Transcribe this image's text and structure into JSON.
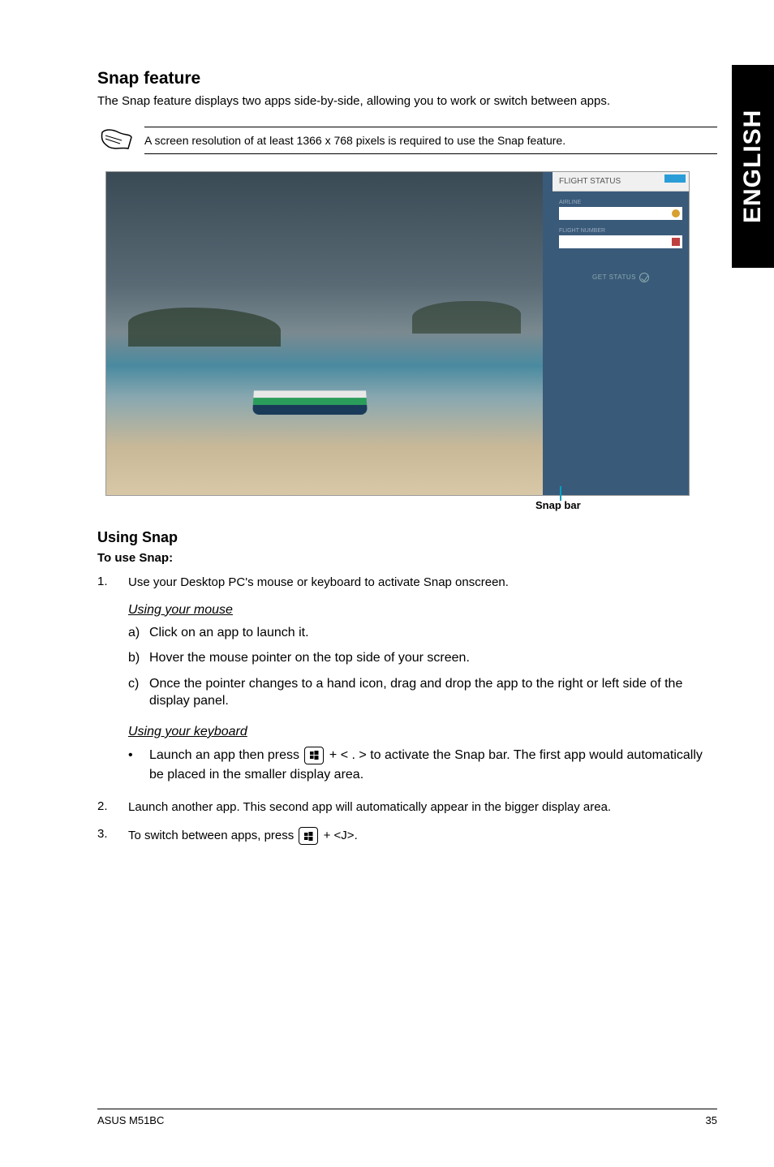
{
  "sideTab": "ENGLISH",
  "title": "Snap feature",
  "intro": "The Snap feature displays two apps side-by-side, allowing you to work or switch between apps.",
  "note": "A screen resolution of at least 1366 x 768 pixels is required to use the Snap feature.",
  "screenshot": {
    "panel_title": "FLIGHT STATUS",
    "field1_label": "AIRLINE",
    "field2_label": "FLIGHT NUMBER",
    "status_text": "GET STATUS"
  },
  "snapBarLabel": "Snap bar",
  "usingTitle": "Using Snap",
  "toUse": "To use Snap:",
  "step1": {
    "num": "1.",
    "text": "Use your Desktop PC's mouse or keyboard to activate Snap onscreen."
  },
  "mouseHeading": "Using your mouse",
  "mouseSteps": {
    "a": {
      "lt": "a)",
      "text": "Click on an app to launch it."
    },
    "b": {
      "lt": "b)",
      "text": "Hover the mouse pointer on the top side of your screen."
    },
    "c": {
      "lt": "c)",
      "text": "Once the pointer changes to a hand icon, drag and drop the app to the right or left side of the display panel."
    }
  },
  "keyboardHeading": "Using your keyboard",
  "kbBullet": {
    "pre": "Launch an app then press ",
    "mid": " + < . > to activate the Snap bar. The first app would automatically be placed in the smaller display area."
  },
  "step2": {
    "num": "2.",
    "text": "Launch another app. This second app will automatically appear in the bigger display area."
  },
  "step3": {
    "num": "3.",
    "pre": "To switch between apps, press ",
    "post": " + <J>."
  },
  "footer": {
    "left": "ASUS M51BC",
    "right": "35"
  }
}
